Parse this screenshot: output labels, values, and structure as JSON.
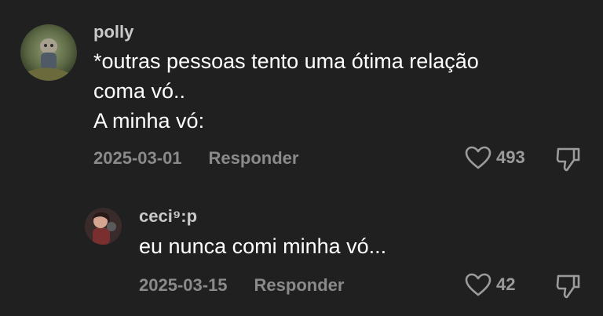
{
  "comments": [
    {
      "username": "polly",
      "lines": [
        "*outras pessoas tento uma ótima relação",
        "coma vó..",
        "A minha vó:"
      ],
      "date": "2025-03-01",
      "reply_label": "Responder",
      "likes": "493"
    },
    {
      "username": "ceci⁹:p",
      "lines": [
        "eu nunca comi minha vó..."
      ],
      "date": "2025-03-15",
      "reply_label": "Responder",
      "likes": "42"
    }
  ],
  "icons": {
    "like": "heart-outline-icon",
    "dislike": "thumbs-down-outline-icon"
  },
  "colors": {
    "background": "#202020",
    "username": "#c9c9c9",
    "text": "#ffffff",
    "meta": "#8a8a8a"
  }
}
